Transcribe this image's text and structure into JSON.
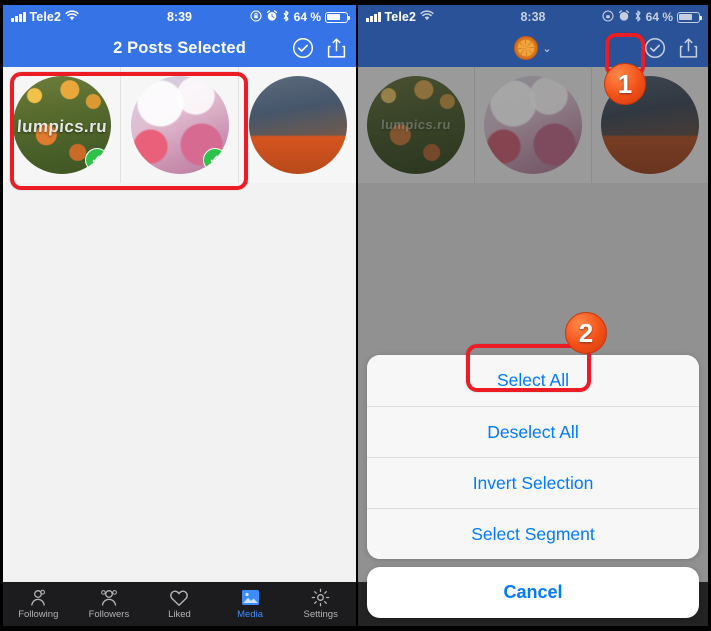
{
  "left_panel": {
    "status_bar": {
      "carrier": "Tele2",
      "time": "8:39",
      "battery_text": "64 %",
      "icons": [
        "signal-bars-icon",
        "wifi-icon",
        "rotation-lock-icon",
        "alarm-icon",
        "bluetooth-icon",
        "battery-icon"
      ]
    },
    "nav": {
      "title": "2 Posts Selected",
      "check_icon": "check-circle-icon",
      "share_icon": "share-upload-icon"
    },
    "thumbnails": [
      {
        "name": "mushroom-forest-photo",
        "watermark": "lumpics.ru",
        "selected": true
      },
      {
        "name": "pink-clouds-photo",
        "watermark": "",
        "selected": true
      },
      {
        "name": "autumn-leaves-photo",
        "watermark": "",
        "selected": false
      }
    ],
    "tabbar": [
      {
        "label": "Following",
        "icon": "person-pair-icon",
        "active": false
      },
      {
        "label": "Followers",
        "icon": "people-group-icon",
        "active": false
      },
      {
        "label": "Liked",
        "icon": "heart-icon",
        "active": false
      },
      {
        "label": "Media",
        "icon": "photo-icon",
        "active": true
      },
      {
        "label": "Settings",
        "icon": "gear-icon",
        "active": false
      }
    ]
  },
  "right_panel": {
    "status_bar": {
      "carrier": "Tele2",
      "time": "8:38",
      "battery_text": "64 %"
    },
    "nav": {
      "avatar_icon": "orange-slice-avatar",
      "chevron_icon": "chevron-down-icon",
      "check_icon": "check-circle-icon",
      "share_icon": "share-upload-icon"
    },
    "action_sheet": {
      "items": [
        {
          "label": "Select All"
        },
        {
          "label": "Deselect All"
        },
        {
          "label": "Invert Selection"
        },
        {
          "label": "Select Segment"
        }
      ],
      "cancel_label": "Cancel"
    },
    "tabbar": [
      {
        "label": "Following",
        "active": false
      },
      {
        "label": "Followers",
        "active": false
      },
      {
        "label": "Liked",
        "active": false
      },
      {
        "label": "Media",
        "active": true
      },
      {
        "label": "Settings",
        "active": false
      }
    ]
  },
  "annotations": {
    "step_one": "1",
    "step_two": "2"
  },
  "colors": {
    "header_blue": "#3573e6",
    "header_blue_dim": "#2a5298",
    "accent_blue": "#007aff",
    "highlight_red": "#ec1c24",
    "check_green": "#2ec24a",
    "badge_orange": "#f24f17"
  }
}
